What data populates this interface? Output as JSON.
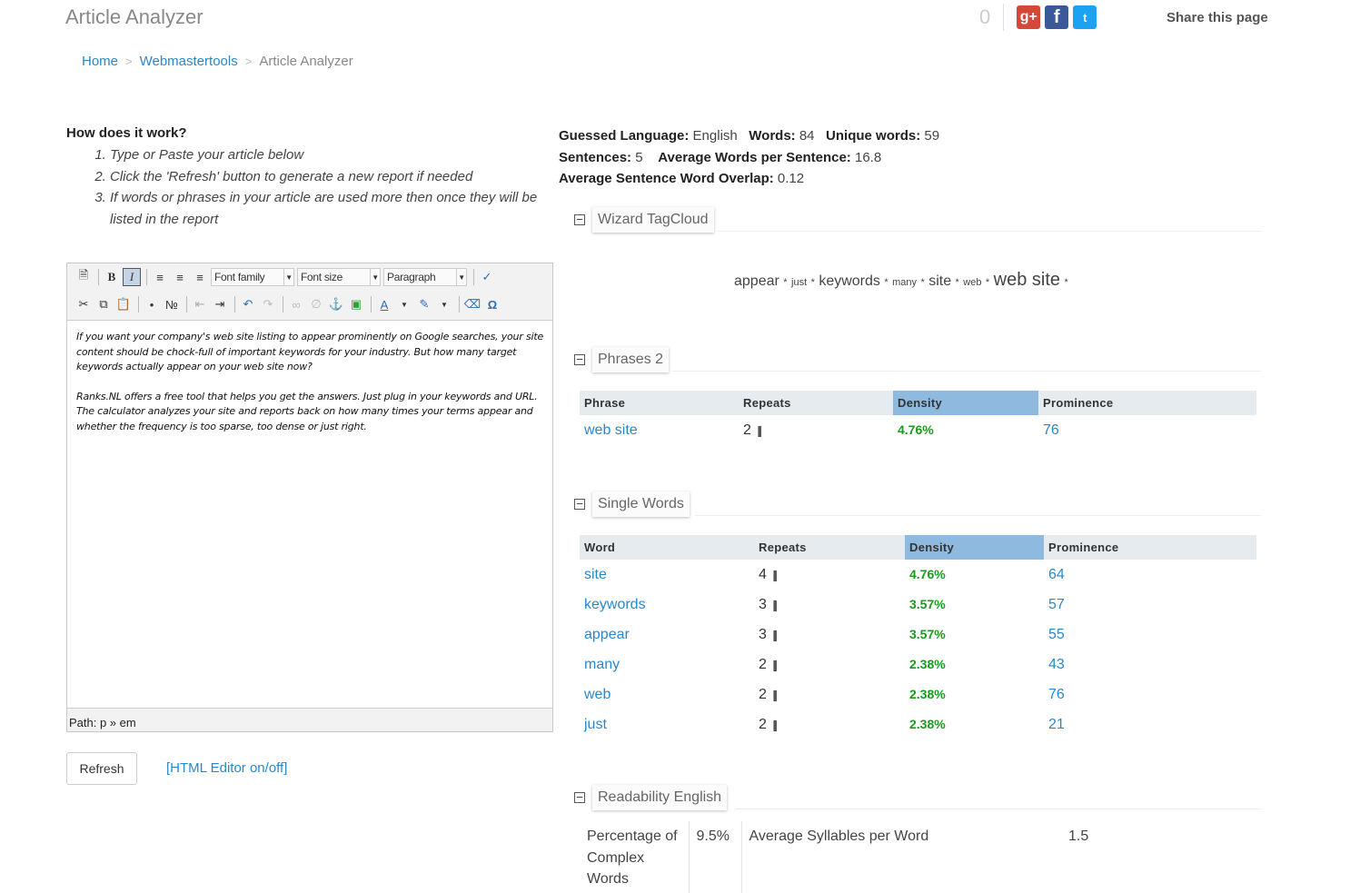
{
  "page": {
    "title": "Article Analyzer"
  },
  "share": {
    "count": "0",
    "gplus": "g+",
    "facebook": "f",
    "twitter": "t",
    "label": "Share this page"
  },
  "breadcrumb": {
    "home": "Home",
    "sep": ">",
    "webmastertools": "Webmastertools",
    "current": "Article Analyzer"
  },
  "how": {
    "heading": "How does it work?",
    "steps": [
      "Type or Paste your article below",
      "Click the 'Refresh' button to generate a new report if needed",
      "If words or phrases in your article are used more then once they will be listed in the report"
    ]
  },
  "editor": {
    "font_family": "Font family",
    "font_size": "Font size",
    "format": "Paragraph",
    "paragraph1": "If you want your company's web site listing to appear prominently on Google searches, your site content should be chock-full of important keywords for your industry. But how many target keywords actually appear on your web site now?",
    "paragraph2": "Ranks.NL offers a free tool that helps you get the answers. Just plug in your keywords and URL. The calculator analyzes your site and reports back on how many times your terms appear and whether the frequency is too sparse, too dense or just right.",
    "path": "Path: p » em"
  },
  "actions": {
    "refresh": "Refresh",
    "html_toggle": "[HTML Editor on/off]"
  },
  "stats": {
    "guessed_language_label": "Guessed Language:",
    "guessed_language": "English",
    "words_label": "Words:",
    "words": "84",
    "unique_words_label": "Unique words:",
    "unique_words": "59",
    "sentences_label": "Sentences:",
    "sentences": "5",
    "avg_words_label": "Average Words per Sentence:",
    "avg_words": "16.8",
    "overlap_label": "Average Sentence Word Overlap:",
    "overlap": "0.12"
  },
  "sections": {
    "tagcloud": "Wizard TagCloud",
    "phrases": "Phrases 2",
    "single": "Single Words",
    "readability": "Readability English"
  },
  "tagcloud": {
    "star": "*",
    "words": [
      "appear",
      "just",
      "keywords",
      "many",
      "site",
      "web",
      "web site"
    ]
  },
  "phrases": {
    "headers": [
      "Phrase",
      "Repeats",
      "Density",
      "Prominence"
    ],
    "rows": [
      {
        "word": "web site",
        "repeats": "2",
        "density": "4.76%",
        "prominence": "76"
      }
    ]
  },
  "single": {
    "headers": [
      "Word",
      "Repeats",
      "Density",
      "Prominence"
    ],
    "rows": [
      {
        "word": "site",
        "repeats": "4",
        "density": "4.76%",
        "prominence": "64"
      },
      {
        "word": "keywords",
        "repeats": "3",
        "density": "3.57%",
        "prominence": "57"
      },
      {
        "word": "appear",
        "repeats": "3",
        "density": "3.57%",
        "prominence": "55"
      },
      {
        "word": "many",
        "repeats": "2",
        "density": "2.38%",
        "prominence": "43"
      },
      {
        "word": "web",
        "repeats": "2",
        "density": "2.38%",
        "prominence": "76"
      },
      {
        "word": "just",
        "repeats": "2",
        "density": "2.38%",
        "prominence": "21"
      }
    ]
  },
  "readability": {
    "complex_label": "Percentage of Complex Words",
    "complex_value": "9.5%",
    "syllables_label": "Average Syllables per Word",
    "syllables_value": "1.5"
  },
  "colors": {
    "link": "#2a88c9",
    "density_green": "#189b1c",
    "density_header": "#8fbadf"
  }
}
